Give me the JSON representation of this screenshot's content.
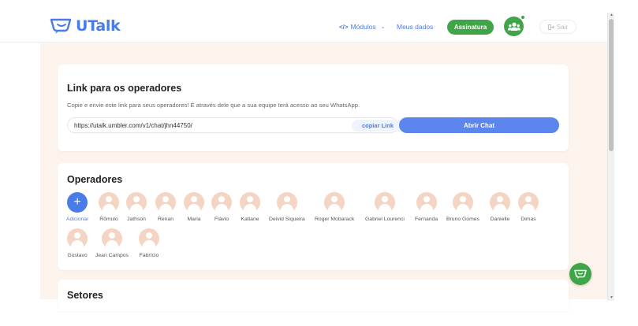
{
  "header": {
    "brand": "UTalk",
    "nav": {
      "modulos": "Módulos",
      "meus_dados": "Meus dados",
      "assinatura": "Assinatura",
      "sair": "Sair"
    }
  },
  "link_card": {
    "title": "Link para os operadores",
    "description": "Copie e envie este link para seus operadores! É através dele que a sua equipe terá acesso ao seu WhatsApp.",
    "url": "https://utalk.umbler.com/v1/chat/jhn44750/",
    "copy_label": "copiar Link",
    "open_label": "Abrir Chat"
  },
  "operators_card": {
    "title": "Operadores",
    "add_label": "Adicionar",
    "operators": [
      "Rômulo",
      "Jathson",
      "Renan",
      "Maria",
      "Flávio",
      "Katiane",
      "Deivid Siqueira",
      "Roger Mobarack",
      "Gabriel Lourenci",
      "Fernanda",
      "Bruno Gomes",
      "Danielle",
      "Dimas",
      "Gustavo",
      "Jean Campos",
      "Fabrício"
    ]
  },
  "sectors_card": {
    "title": "Setores"
  },
  "colors": {
    "brand_blue": "#4a7ce8",
    "brand_green": "#3fa548",
    "page_bg": "#fcf4ec",
    "avatar_placeholder": "#f4d4c2"
  },
  "icons": {
    "logo": "utalk-logo-icon",
    "modulos": "code-icon",
    "group": "users-group-icon",
    "sair": "logout-icon",
    "fab": "chat-icon"
  }
}
